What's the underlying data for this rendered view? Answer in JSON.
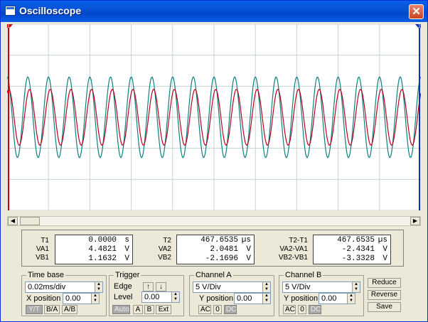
{
  "window": {
    "title": "Oscilloscope",
    "close_glyph": "✕"
  },
  "colors": {
    "channel_a": "#c00020",
    "channel_b": "#0e8080",
    "grid": "#c8d2d2",
    "screen_bg": "#ffffff"
  },
  "cursors": {
    "t1_label": "1",
    "t2_label": "2"
  },
  "chart_data": {
    "type": "line",
    "grid": {
      "x_divisions": 10,
      "y_divisions": 6
    },
    "timebase_ms_per_div": 0.02,
    "cycles_on_screen": 20,
    "series": [
      {
        "channel": "A",
        "amplitude_div": 0.9,
        "phase_deg": -30
      },
      {
        "channel": "B",
        "amplitude_div": 1.3,
        "phase_deg": 0
      }
    ]
  },
  "measurements": {
    "cursor1": {
      "header": "T1",
      "rows": [
        {
          "label": "T1",
          "value": "0.0000",
          "unit": "s"
        },
        {
          "label": "VA1",
          "value": "4.4821",
          "unit": "V"
        },
        {
          "label": "VB1",
          "value": "1.1632",
          "unit": "V"
        }
      ]
    },
    "cursor2": {
      "rows": [
        {
          "label": "T2",
          "value": "467.6535",
          "unit": "µs"
        },
        {
          "label": "VA2",
          "value": "2.0481",
          "unit": "V"
        },
        {
          "label": "VB2",
          "value": "-2.1696",
          "unit": "V"
        }
      ]
    },
    "delta": {
      "rows": [
        {
          "label": "T2-T1",
          "value": "467.6535",
          "unit": "µs"
        },
        {
          "label": "VA2-VA1",
          "value": "-2.4341",
          "unit": "V"
        },
        {
          "label": "VB2-VB1",
          "value": "-3.3328",
          "unit": "V"
        }
      ]
    }
  },
  "timebase": {
    "title": "Time base",
    "scale": "0.02ms/div",
    "xpos_label": "X position",
    "xpos_value": "0.00",
    "buttons": [
      "Y/T",
      "B/A",
      "A/B"
    ]
  },
  "trigger": {
    "title": "Trigger",
    "edge_label": "Edge",
    "level_label": "Level",
    "level_value": "0.00",
    "buttons": [
      "Auto",
      "A",
      "B",
      "Ext"
    ]
  },
  "channel_a": {
    "title": "Channel A",
    "scale": "5 V/Div",
    "ypos_label": "Y position",
    "ypos_value": "0.00",
    "buttons": [
      "AC",
      "0",
      "DC"
    ]
  },
  "channel_b": {
    "title": "Channel B",
    "scale": "5 V/Div",
    "ypos_label": "Y position",
    "ypos_value": "0.00",
    "buttons": [
      "AC",
      "0",
      "DC"
    ]
  },
  "actions": {
    "reduce": "Reduce",
    "reverse": "Reverse",
    "save": "Save"
  }
}
